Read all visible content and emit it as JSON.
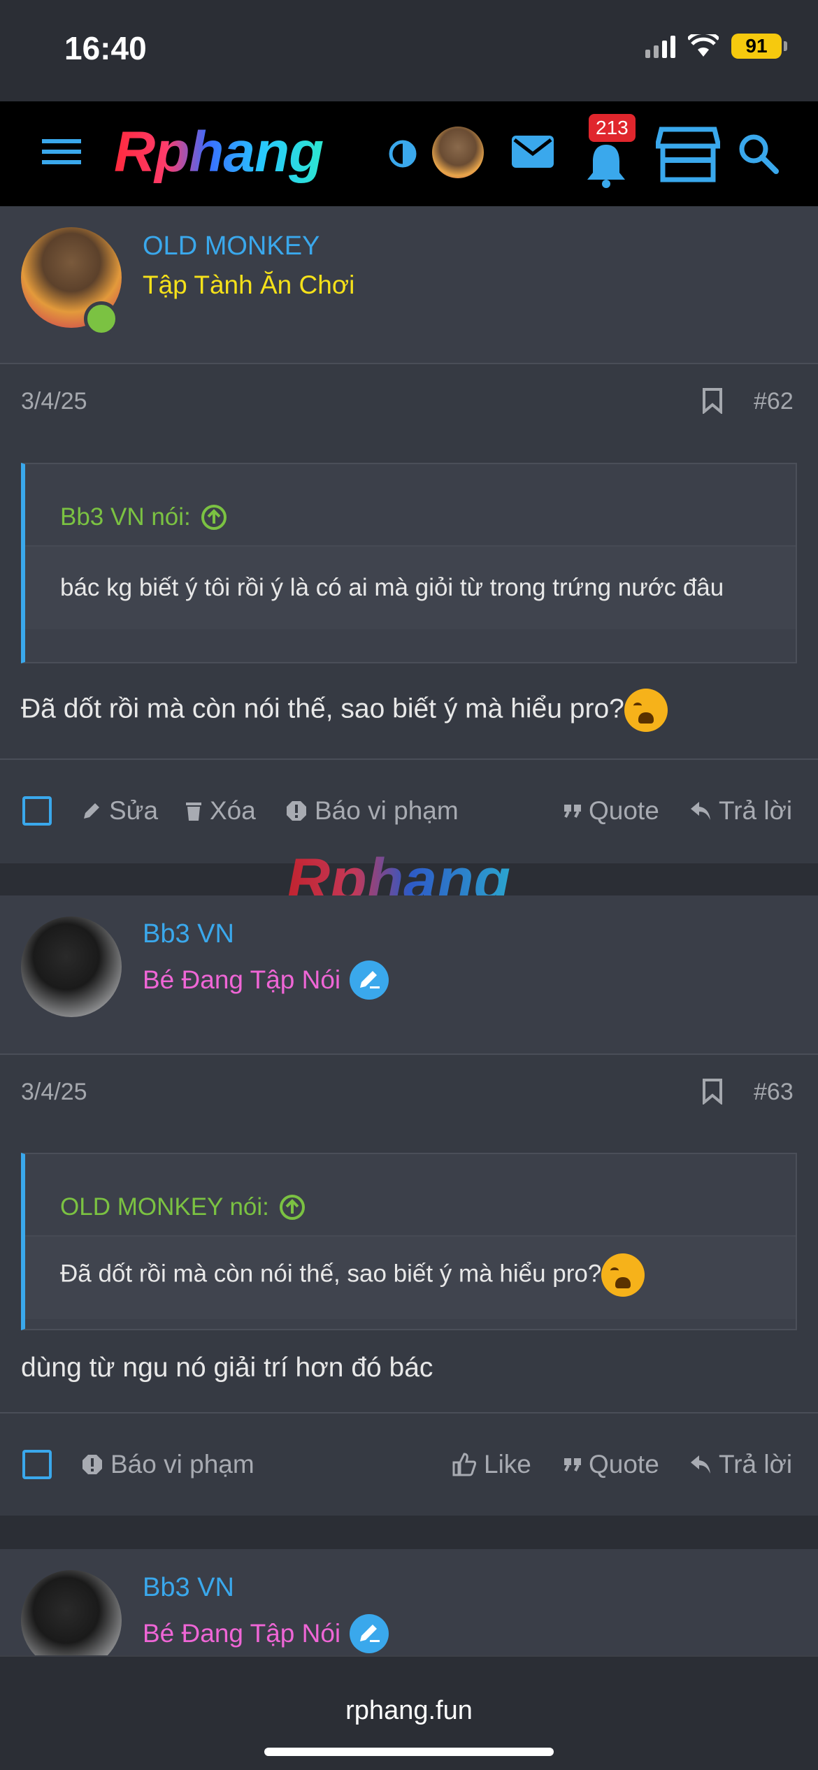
{
  "status": {
    "time": "16:40",
    "battery": "91"
  },
  "nav": {
    "logo": "Rphang",
    "notification_count": "213"
  },
  "watermark": "Rphang",
  "posts": [
    {
      "username": "OLD MONKEY",
      "usertitle": "Tập Tành Ăn Chơi",
      "date": "3/4/25",
      "number": "#62",
      "quote_author": "Bb3 VN nói:",
      "quote_text": "bác kg biết ý tôi rồi ý là có ai mà giỏi từ trong trứng nước đâu",
      "message": "Đã dốt rồi mà còn nói thế, sao biết ý mà hiểu pro?",
      "actions": {
        "edit": "Sửa",
        "delete": "Xóa",
        "report": "Báo vi phạm",
        "quote": "Quote",
        "reply": "Trả lời"
      }
    },
    {
      "username": "Bb3 VN",
      "usertitle": "Bé Đang Tập Nói",
      "date": "3/4/25",
      "number": "#63",
      "quote_author": "OLD MONKEY nói:",
      "quote_text": "Đã dốt rồi mà còn nói thế, sao biết ý mà hiểu pro?",
      "message": "dùng từ ngu nó giải trí hơn đó bác",
      "actions": {
        "report": "Báo vi phạm",
        "like": "Like",
        "quote": "Quote",
        "reply": "Trả lời"
      }
    },
    {
      "username": "Bb3 VN",
      "usertitle": "Bé Đang Tập Nói"
    }
  ],
  "browser": {
    "url": "rphang.fun"
  },
  "colors": {
    "accent": "#3aa8ec",
    "quote_green": "#7bc242",
    "title_yellow": "#f5e11a",
    "title_pink": "#ef66d6"
  }
}
